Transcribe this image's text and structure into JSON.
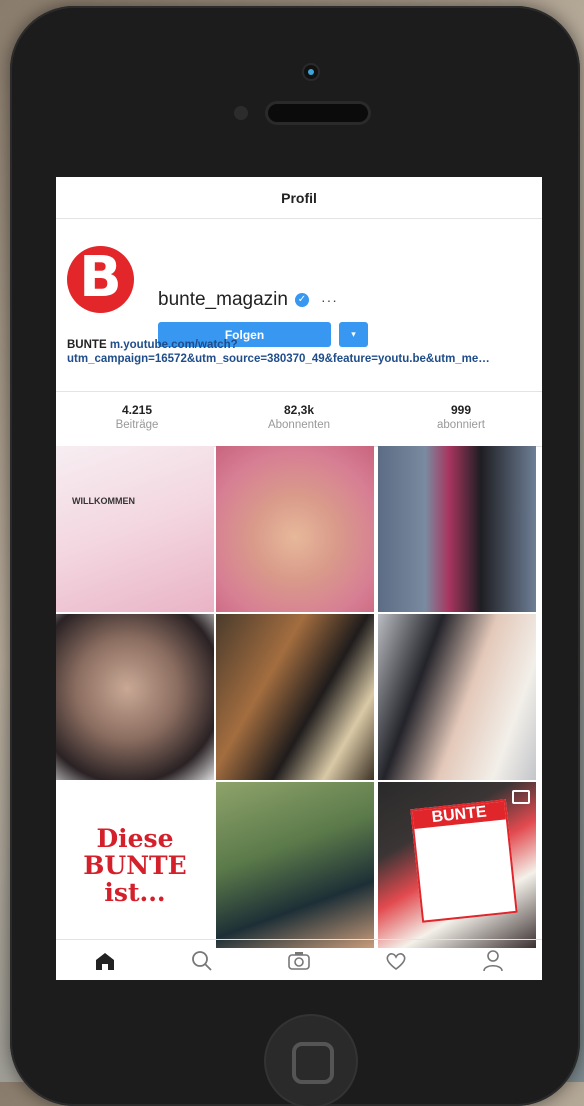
{
  "screen": {
    "title": "Profil"
  },
  "profile": {
    "logo_letter": "B",
    "username": "bunte_magazin",
    "more": "···",
    "follow_label": "Folgen",
    "dropdown_label": "▾",
    "bio_name": "BUNTE",
    "bio_link": "m.youtube.com/watch?utm_campaign=16572&utm_source=380370_49&feature=youtu.be&utm_me…"
  },
  "stats": [
    {
      "value": "4.215",
      "label": "Beiträge"
    },
    {
      "value": "82,3k",
      "label": "Abonnenten"
    },
    {
      "value": "999",
      "label": "abonniert"
    }
  ],
  "grid": {
    "post1_text": "WILLKOMMEN",
    "post7_lines": [
      "Diese",
      "BUNTE",
      "ist..."
    ],
    "post9_text": "BUNTE"
  },
  "tabbar": [
    "home-icon",
    "search-icon",
    "camera-icon",
    "heart-icon",
    "profile-icon"
  ],
  "colors": {
    "accent": "#3897f0",
    "brand": "#e3262a"
  }
}
